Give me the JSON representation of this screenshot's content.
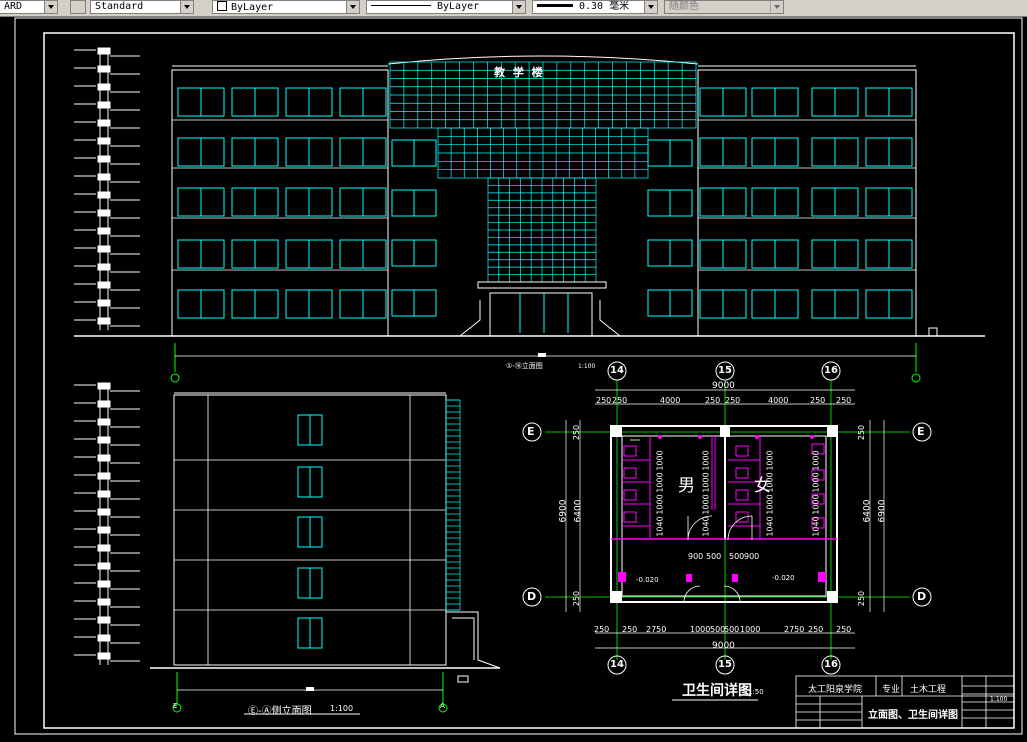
{
  "toolbar": {
    "textstyle_partial": "ARD",
    "dimstyle": "Standard",
    "layer_color": "ByLayer",
    "linetype": "ByLayer",
    "lineweight": "0.30 毫米",
    "plotstyle": "随颜色"
  },
  "front_elevation": {
    "building_sign": "教 学 楼",
    "title_label": "①-⑱立面图",
    "scale": "1:100"
  },
  "side_elevation": {
    "title_label": "Ⓔ-Ⓐ侧立面图",
    "scale": "1:100",
    "axis_left": "E",
    "axis_right": "A"
  },
  "toilet_detail": {
    "title": "卫生间详图",
    "scale": "1:50",
    "axis_top": [
      "14",
      "15",
      "16"
    ],
    "axis_bottom": [
      "14",
      "15",
      "16"
    ],
    "axis_rows": [
      "E",
      "D"
    ],
    "dim_total": "9000",
    "dim_top_segments": [
      "250",
      "250",
      "4000",
      "250",
      "250",
      "4000",
      "250",
      "250"
    ],
    "dim_bottom_segments": [
      "250",
      "250",
      "2750",
      "1000",
      "500",
      "500",
      "1000",
      "2750",
      "250",
      "250"
    ],
    "dim_left": [
      "250",
      "6400",
      "250"
    ],
    "dim_left_outer": "6900",
    "dim_right": [
      "250",
      "6400",
      "250"
    ],
    "dim_right_outer": "6900",
    "male_label": "男",
    "female_label": "女",
    "stall_dims": [
      "1000",
      "1000",
      "1000",
      "1040"
    ],
    "stall_dim_small": [
      "40",
      "40",
      "40"
    ],
    "door_dims": [
      "900",
      "500",
      "500",
      "900"
    ],
    "level_left": "-0.020",
    "level_right": "-0.020"
  },
  "title_block": {
    "school": "太工阳泉学院",
    "major_label": "专业",
    "major": "土木工程",
    "drawing_name": "立面图、卫生间详图",
    "scale": "1:100"
  }
}
